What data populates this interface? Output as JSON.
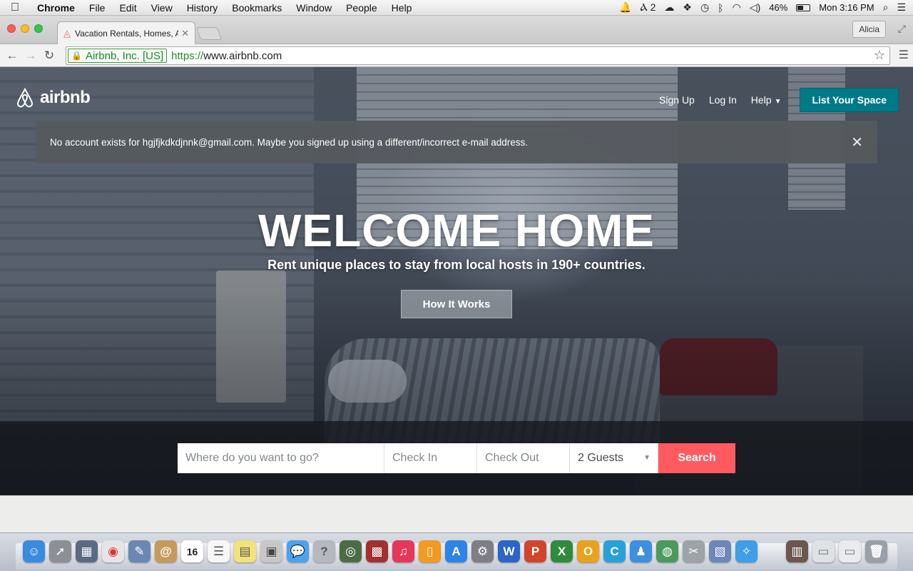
{
  "menubar": {
    "apple_icon": "apple-logo-icon",
    "app_name": "Chrome",
    "items": [
      "File",
      "Edit",
      "View",
      "History",
      "Bookmarks",
      "Window",
      "People",
      "Help"
    ],
    "status": {
      "adobe_count": "2",
      "battery_percent": "46%",
      "battery_level": 0.46,
      "clock": "Mon 3:16 PM"
    }
  },
  "browser": {
    "tab_title": "Vacation Rentals, Homes, A",
    "profile_name": "Alicia",
    "ev_label": "Airbnb, Inc. [US]",
    "url_scheme": "https://",
    "url_host": "www.airbnb.com"
  },
  "page": {
    "brand": "airbnb",
    "nav": {
      "sign_up": "Sign Up",
      "log_in": "Log In",
      "help": "Help",
      "list_space": "List Your Space"
    },
    "alert": {
      "message": "No account exists for hgjfjkdkdjnnk@gmail.com. Maybe you signed up using a different/incorrect e-mail address.",
      "close_glyph": "✕"
    },
    "hero": {
      "headline": "WELCOME HOME",
      "subheadline": "Rent unique places to stay from local hosts in 190+ countries.",
      "how_it_works": "How It Works"
    },
    "search": {
      "where_placeholder": "Where do you want to go?",
      "check_in_placeholder": "Check In",
      "check_out_placeholder": "Check Out",
      "guests_value": "2 Guests",
      "button": "Search"
    }
  },
  "dock": {
    "calendar_day": "16",
    "left_apps": [
      "finder",
      "launchpad",
      "mission-control",
      "chrome",
      "preview",
      "contacts",
      "calendar",
      "reminders",
      "stickies",
      "photo-booth",
      "messages",
      "help",
      "facetime",
      "photo-browser",
      "itunes",
      "ibooks",
      "app-store",
      "system-preferences",
      "word",
      "powerpoint",
      "excel",
      "outlook",
      "onenote",
      "lync",
      "network",
      "utility",
      "photo-gallery",
      "safari"
    ],
    "colors": {
      "accent_brand": "#ff5a5f",
      "list_space": "#007a87"
    }
  }
}
